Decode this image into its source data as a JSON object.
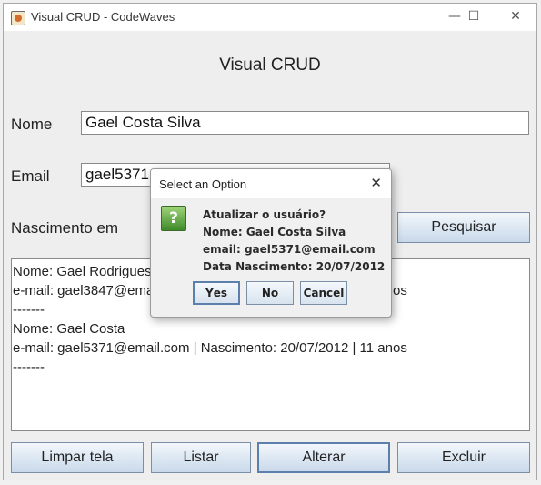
{
  "window": {
    "title": "Visual CRUD - CodeWaves",
    "controls": {
      "minimize": "—",
      "maximize": "☐",
      "close": "✕"
    }
  },
  "form": {
    "heading": "Visual CRUD",
    "nome_label": "Nome",
    "nome_value": "Gael Costa Silva",
    "email_label": "Email",
    "email_value": "gael5371@email.com",
    "nascimento_label": "Nascimento em",
    "search_button": "Pesquisar"
  },
  "output": {
    "lines": [
      "Nome: Gael Rodrigues",
      "e-mail: gael3847@email.com | Nascimento: 20/07/2012 | 11 anos",
      "-------",
      "Nome: Gael Costa",
      "e-mail: gael5371@email.com | Nascimento: 20/07/2012 | 11 anos",
      "-------"
    ]
  },
  "actions": {
    "limpar": "Limpar tela",
    "listar": "Listar",
    "alterar": "Alterar",
    "excluir": "Excluir"
  },
  "dialog": {
    "title": "Select an Option",
    "close": "✕",
    "icon": "question-icon",
    "question": "Atualizar o usuário?",
    "nome_line": "Nome: Gael Costa Silva",
    "email_line": "email: gael5371@email.com",
    "data_line": "Data Nascimento: 20/07/2012",
    "yes_mnemonic": "Y",
    "yes_rest": "es",
    "no_mnemonic": "N",
    "no_rest": "o",
    "cancel": "Cancel"
  }
}
